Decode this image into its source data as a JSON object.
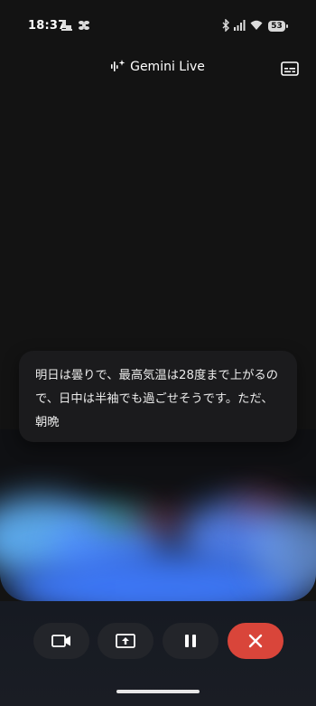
{
  "status_bar": {
    "time": "18:37",
    "battery": "53"
  },
  "header": {
    "title": "Gemini Live"
  },
  "transcript": {
    "text": "明日は曇りで、最高気温は28度まで上がるので、日中は半袖でも過ごせそうです。ただ、朝晩"
  },
  "controls": {
    "items": [
      "video-icon",
      "screen-share-icon",
      "pause-icon",
      "close-icon"
    ]
  },
  "colors": {
    "background": "#131313",
    "end_call": "#d9453a",
    "control_bg": "#23252a",
    "wave_blue": "#3f7bff",
    "wave_green": "#4cc08a",
    "wave_red": "#e45b7a"
  }
}
